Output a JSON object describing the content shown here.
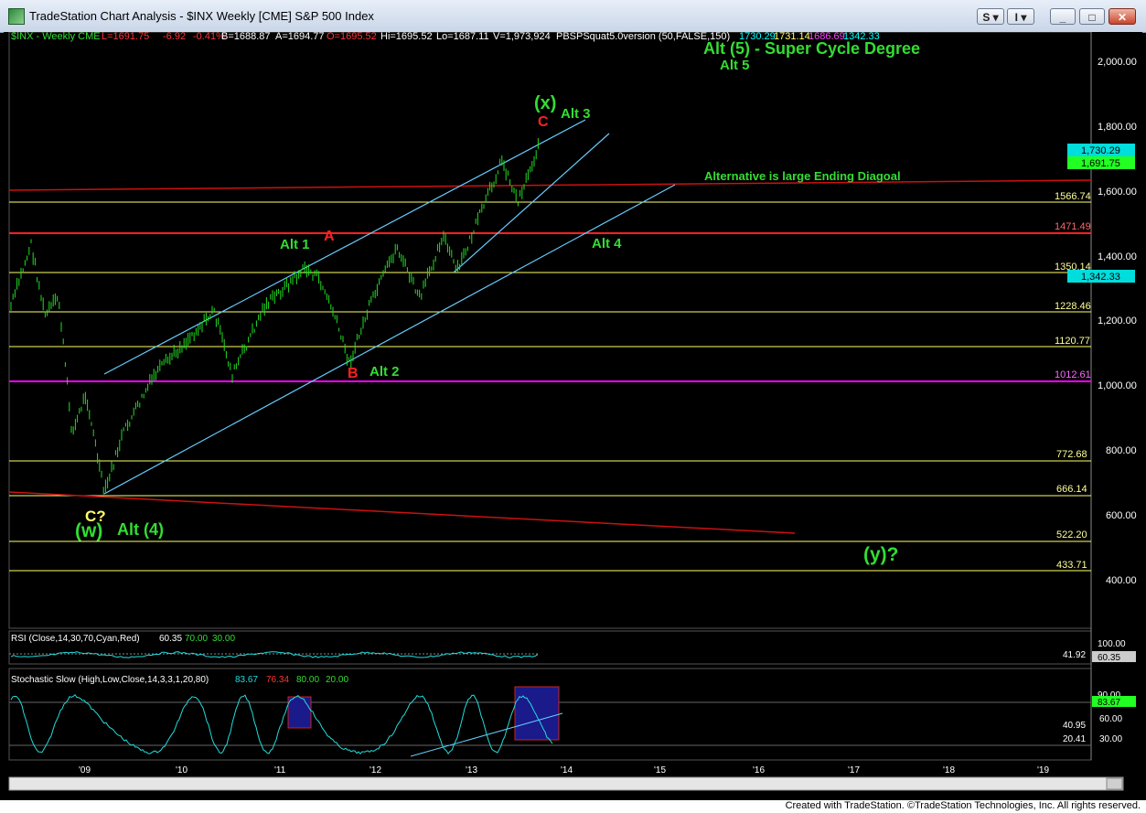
{
  "window": {
    "title": "TradeStation Chart Analysis - $INX Weekly [CME] S&P 500 Index",
    "buttons": [
      "S",
      "I",
      "_",
      "□",
      "✕"
    ]
  },
  "header": {
    "symbol": "$INX - Weekly  CME",
    "last": "L=1691.75",
    "change": "-6.92",
    "pct": "-0.41%",
    "bid": "B=1688.87",
    "ask": "A=1694.77",
    "open": "O=1695.52",
    "hi": "Hi=1695.52",
    "lo": "Lo=1687.11",
    "vol": "V=1,973,924",
    "study": "PBSPSquat5.0version (50,FALSE,150)",
    "study_vals": [
      "1730.29",
      "1731.14",
      "1686.69",
      "1342.33"
    ]
  },
  "colors": {
    "background": "#000000",
    "green": "#00ff00",
    "bright_green": "#33dd33",
    "red": "#ff0000",
    "yellow": "#ffff66",
    "cyan": "#00ffff",
    "magenta": "#ff00ff",
    "channel": "#66ccff"
  },
  "price_axis": {
    "ticks": [
      "2,000.00",
      "1,800.00",
      "1,600.00",
      "1,400.00",
      "1,200.00",
      "1,000.00",
      "800.00",
      "600.00",
      "400.00"
    ]
  },
  "levels": [
    {
      "label": "1566.74",
      "kind": "yellow"
    },
    {
      "label": "1471.49",
      "kind": "red"
    },
    {
      "label": "1350.14",
      "kind": "yellow"
    },
    {
      "label": "1228.46",
      "kind": "yellow"
    },
    {
      "label": "1120.77",
      "kind": "yellow"
    },
    {
      "label": "1012.61",
      "kind": "magenta"
    },
    {
      "label": "772.68",
      "kind": "yellow"
    },
    {
      "label": "666.14",
      "kind": "yellow"
    },
    {
      "label": "522.20",
      "kind": "yellow"
    },
    {
      "label": "433.71",
      "kind": "yellow"
    }
  ],
  "price_badges": [
    {
      "label": "1,730.29",
      "kind": "cyan"
    },
    {
      "label": "1,691.75",
      "kind": "green"
    },
    {
      "label": "1,342.33",
      "kind": "cyan"
    }
  ],
  "annotations": {
    "headline": "Alt (5) - Super Cycle Degree",
    "alt5": "Alt 5",
    "ending_diagonal": "Alternative is large Ending Diagoal",
    "x_wave": "(x)",
    "alt3": "Alt 3",
    "c_top": "C",
    "alt1": "Alt 1",
    "alt2": "Alt 2",
    "alt4": "Alt 4",
    "a_label": "A",
    "b_label": "B",
    "w_label": "(w)",
    "alt_4_paren": "Alt (4)",
    "c_question": "C?",
    "y_question": "(y)?"
  },
  "rsi": {
    "title": "RSI (Close,14,30,70,Cyan,Red)",
    "values": [
      "60.35",
      "70.00",
      "30.00"
    ],
    "axis": [
      "100.00",
      "41.92",
      "60.35"
    ]
  },
  "stochastic": {
    "title": "Stochastic Slow (High,Low,Close,14,3,3,1,20,80)",
    "values": [
      "83.67",
      "76.34",
      "80.00",
      "20.00"
    ],
    "axis": [
      "90.00",
      "83.67",
      "60.00",
      "40.95",
      "30.00",
      "20.41"
    ]
  },
  "time_axis": [
    "'09",
    "'10",
    "'11",
    "'12",
    "'13",
    "'14",
    "'15",
    "'16",
    "'17",
    "'18",
    "'19"
  ],
  "status": {
    "credit": "Created with TradeStation. ©TradeStation Technologies, Inc. All rights reserved."
  }
}
